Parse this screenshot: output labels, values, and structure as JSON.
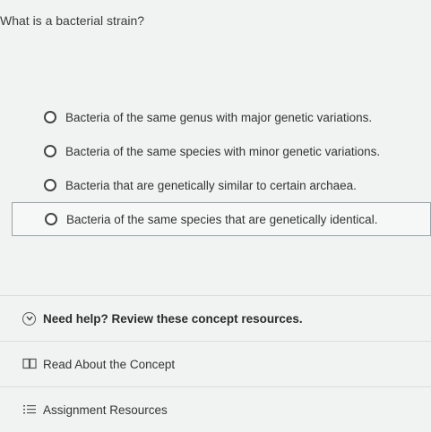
{
  "question": {
    "text": "What is a bacterial strain?"
  },
  "options": [
    {
      "label": "Bacteria of the same genus with major genetic variations.",
      "selected": false
    },
    {
      "label": "Bacteria of the same species with minor genetic variations.",
      "selected": false
    },
    {
      "label": "Bacteria that are genetically similar to certain archaea.",
      "selected": false
    },
    {
      "label": "Bacteria of the same species that are genetically identical.",
      "selected": true
    }
  ],
  "help": {
    "title": "Need help? Review these concept resources.",
    "read_concept": "Read About the Concept",
    "assignment_resources": "Assignment Resources"
  },
  "icons": {
    "expand": "chevron-down-circle-icon",
    "book": "book-icon",
    "list": "list-icon"
  }
}
